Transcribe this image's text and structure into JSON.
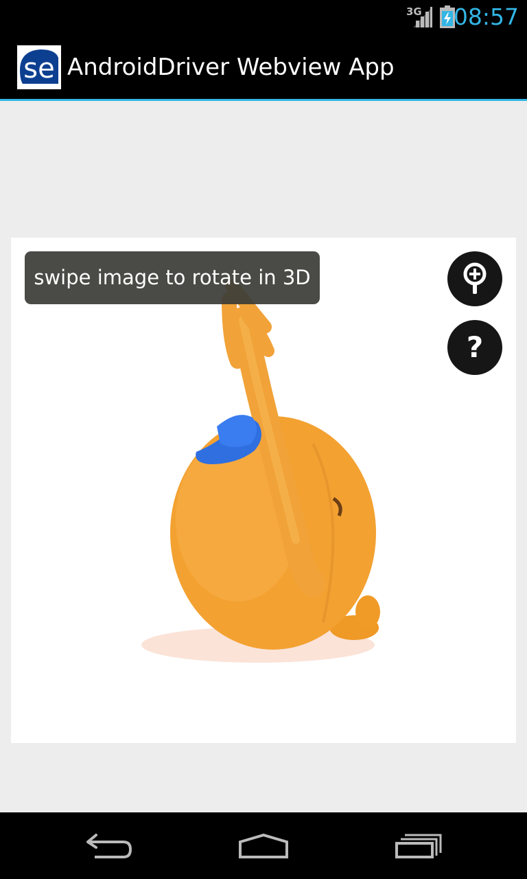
{
  "status_bar": {
    "network_type": "3G",
    "signal_icon": "signal-bars-icon",
    "battery_icon": "battery-charging-icon",
    "time": "08:57",
    "time_color": "#33b5e5"
  },
  "action_bar": {
    "app_icon": "selenium-logo-icon",
    "app_icon_text": "se",
    "title": "AndroidDriver Webview App",
    "accent_color": "#33b5e5"
  },
  "viewer": {
    "image": "orange-plush-toy-image",
    "hint": "swipe image to rotate in 3D",
    "zoom_icon": "zoom-in-icon",
    "help_icon": "help-icon",
    "help_label": "?"
  },
  "nav_bar": {
    "back_icon": "back-icon",
    "home_icon": "home-icon",
    "recent_icon": "recent-apps-icon"
  }
}
